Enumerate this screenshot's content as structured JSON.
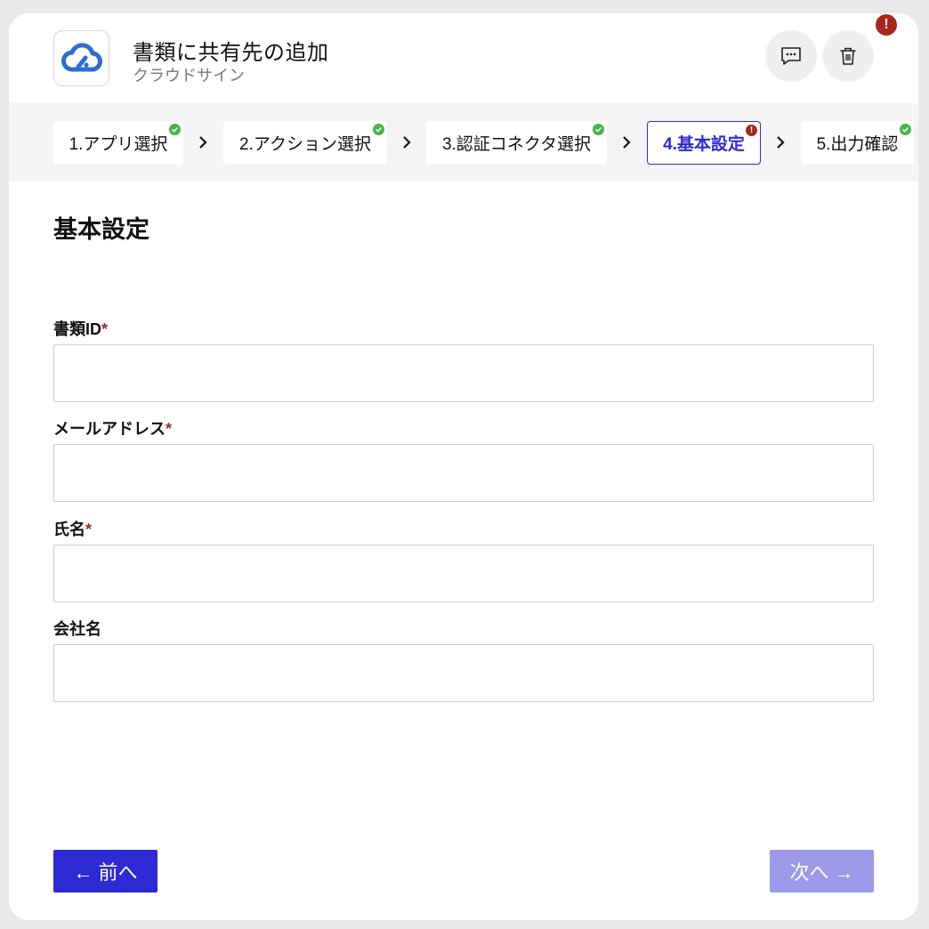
{
  "header": {
    "title": "書類に共有先の追加",
    "subtitle": "クラウドサイン",
    "app_icon": "cloud-sign-icon",
    "alert_badge": "!"
  },
  "steps": [
    {
      "label": "1.アプリ選択",
      "status": "done"
    },
    {
      "label": "2.アクション選択",
      "status": "done"
    },
    {
      "label": "3.認証コネクタ選択",
      "status": "done"
    },
    {
      "label": "4.基本設定",
      "status": "error",
      "active": true
    },
    {
      "label": "5.出力確認",
      "status": "done"
    }
  ],
  "step_warn_symbol": "!",
  "section": {
    "title": "基本設定"
  },
  "fields": [
    {
      "label": "書類ID",
      "required": "*",
      "value": ""
    },
    {
      "label": "メールアドレス",
      "required": "*",
      "value": ""
    },
    {
      "label": "氏名",
      "required": "*",
      "value": ""
    },
    {
      "label": "会社名",
      "required": "",
      "value": ""
    }
  ],
  "buttons": {
    "prev": "← 前へ",
    "next": "次へ →"
  },
  "colors": {
    "primary": "#2d2ad3",
    "primary_disabled": "#9c9ae8",
    "error": "#a7261d",
    "success": "#45b54a",
    "brand_icon": "#2c6fd1"
  }
}
